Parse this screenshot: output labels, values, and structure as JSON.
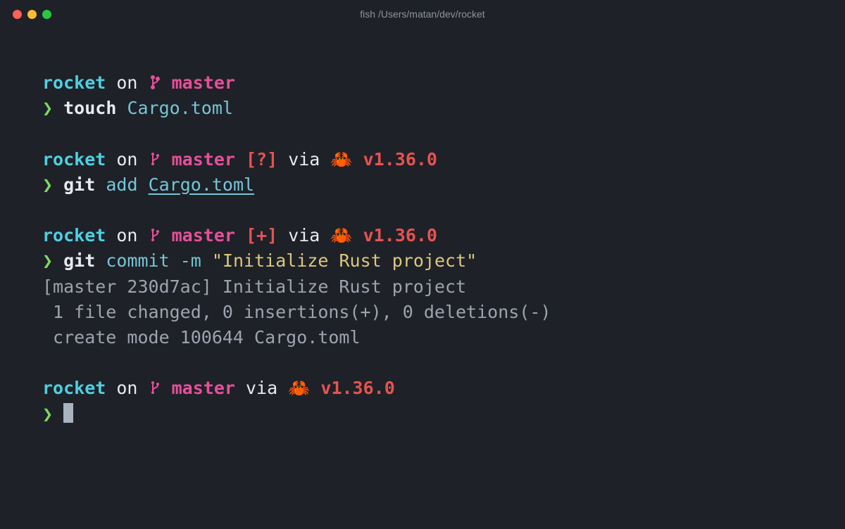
{
  "window": {
    "title": "fish /Users/matan/dev/rocket"
  },
  "prompts": [
    {
      "dir": "rocket",
      "on": "on",
      "branch": "master",
      "status": "",
      "via": "",
      "lang_icon": "",
      "version": "",
      "arrow": "❯",
      "cmd_main": "touch",
      "cmd_arg1": "Cargo.toml",
      "cmd_flag": "",
      "cmd_string": ""
    },
    {
      "dir": "rocket",
      "on": "on",
      "branch": "master",
      "status": "[?]",
      "via": "via",
      "lang_icon": "🦀",
      "version": "v1.36.0",
      "arrow": "❯",
      "cmd_main": "git",
      "cmd_sub": "add",
      "cmd_arg1": "Cargo.toml",
      "cmd_flag": "",
      "cmd_string": ""
    },
    {
      "dir": "rocket",
      "on": "on",
      "branch": "master",
      "status": "[+]",
      "via": "via",
      "lang_icon": "🦀",
      "version": "v1.36.0",
      "arrow": "❯",
      "cmd_main": "git",
      "cmd_sub": "commit",
      "cmd_flag": "-m",
      "cmd_string": "\"Initialize Rust project\""
    },
    {
      "dir": "rocket",
      "on": "on",
      "branch": "master",
      "status": "",
      "via": "via",
      "lang_icon": "🦀",
      "version": "v1.36.0",
      "arrow": "❯",
      "cmd_main": "",
      "cmd_sub": "",
      "cmd_flag": "",
      "cmd_string": ""
    }
  ],
  "output": {
    "l1": "[master 230d7ac] Initialize Rust project",
    "l2": " 1 file changed, 0 insertions(+), 0 deletions(-)",
    "l3": " create mode 100644 Cargo.toml"
  }
}
